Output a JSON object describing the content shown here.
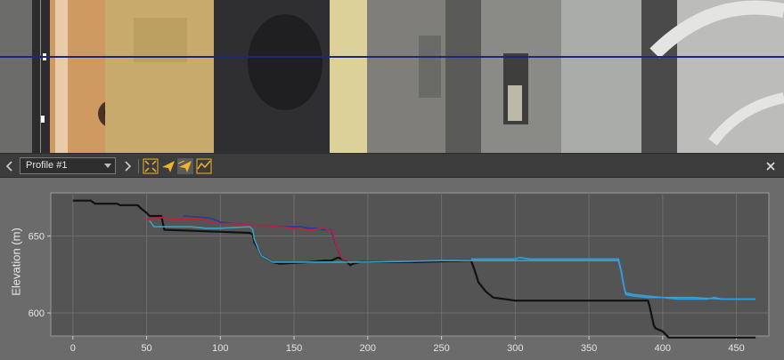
{
  "toolbar": {
    "profile_name": "Profile #1",
    "prev_icon": "chevron-left-icon",
    "next_icon": "chevron-right-icon",
    "tools": [
      "fit-extent-icon",
      "send-icon",
      "send-all-icon",
      "profile-lines-icon"
    ],
    "close_icon": "close-icon",
    "accent": "#f0b429"
  },
  "colors": {
    "panel_bg": "#6b6b6b",
    "toolbar_bg": "#3c3c3c",
    "profile_line": "#1a2a7a"
  },
  "chart_data": {
    "type": "line",
    "ylabel": "Elevation (m)",
    "xlabel": "",
    "xlim": [
      -15,
      472
    ],
    "ylim": [
      585,
      678
    ],
    "x_ticks": [
      0,
      50,
      100,
      150,
      200,
      250,
      300,
      350,
      400,
      450
    ],
    "y_ticks": [
      600,
      650
    ],
    "grid": true,
    "series": [
      {
        "color": "#111111",
        "x": [
          0,
          12,
          15,
          30,
          32,
          44,
          46,
          50,
          52,
          60,
          62,
          120,
          122,
          123,
          126,
          128,
          132,
          135,
          140,
          160,
          170,
          175,
          180,
          185,
          188,
          190,
          195,
          200,
          230,
          270,
          272,
          275,
          280,
          285,
          300,
          330,
          360,
          380,
          390,
          391,
          393,
          394,
          395,
          400,
          404,
          420,
          440,
          450,
          463
        ],
        "y": [
          673,
          673,
          671,
          671,
          670,
          670,
          668,
          665,
          663,
          663,
          654,
          652,
          651,
          646,
          641,
          637,
          635,
          633,
          632,
          633,
          634,
          634,
          636,
          634,
          631,
          632,
          633,
          633,
          633,
          634,
          629,
          620,
          614,
          610,
          608,
          608,
          608,
          608,
          608,
          605,
          596,
          592,
          590,
          588,
          584,
          584,
          584,
          584,
          584
        ]
      },
      {
        "color": "#1a3f9e",
        "x": [
          75,
          90,
          95,
          100,
          110,
          120,
          130,
          140,
          150,
          155,
          160,
          165,
          170,
          175,
          178,
          182,
          185
        ],
        "y": [
          663,
          662,
          661,
          659,
          658,
          657,
          657,
          656,
          656,
          656,
          655,
          655,
          654,
          654,
          645,
          636,
          633
        ]
      },
      {
        "color": "#c41e3a",
        "x": [
          50,
          60,
          70,
          90,
          92,
          100,
          110,
          120,
          130,
          140,
          150,
          160,
          170,
          176,
          179,
          183,
          190
        ],
        "y": [
          661,
          662,
          661,
          661,
          659,
          658,
          658,
          657,
          657,
          656,
          655,
          654,
          655,
          653,
          643,
          635,
          633
        ]
      },
      {
        "color": "#3aa0c8",
        "x": [
          52,
          55,
          60,
          70,
          80,
          90,
          100,
          120,
          122,
          123,
          126,
          128,
          132,
          135,
          140,
          160,
          170,
          180,
          190,
          200,
          250,
          270,
          300,
          340,
          370,
          372,
          373,
          374,
          375,
          380,
          390,
          400,
          420,
          440,
          463
        ],
        "y": [
          660,
          656,
          656,
          656,
          656,
          655,
          655,
          656,
          654,
          648,
          641,
          637,
          635,
          633,
          633,
          633,
          633,
          633,
          633,
          633,
          634,
          634,
          634,
          634,
          634,
          626,
          620,
          616,
          613,
          612,
          611,
          610,
          610,
          609,
          609
        ]
      },
      {
        "color": "#2aa0e8",
        "x": [
          270,
          280,
          300,
          303,
          310,
          320,
          330,
          340,
          350,
          360,
          370,
          372,
          373,
          374,
          375,
          380,
          390,
          400,
          410,
          430,
          435,
          440,
          463
        ],
        "y": [
          635,
          635,
          635,
          636,
          635,
          635,
          635,
          635,
          635,
          635,
          635,
          627,
          621,
          616,
          612,
          611,
          610,
          610,
          609,
          609,
          610,
          609,
          609
        ]
      }
    ]
  }
}
